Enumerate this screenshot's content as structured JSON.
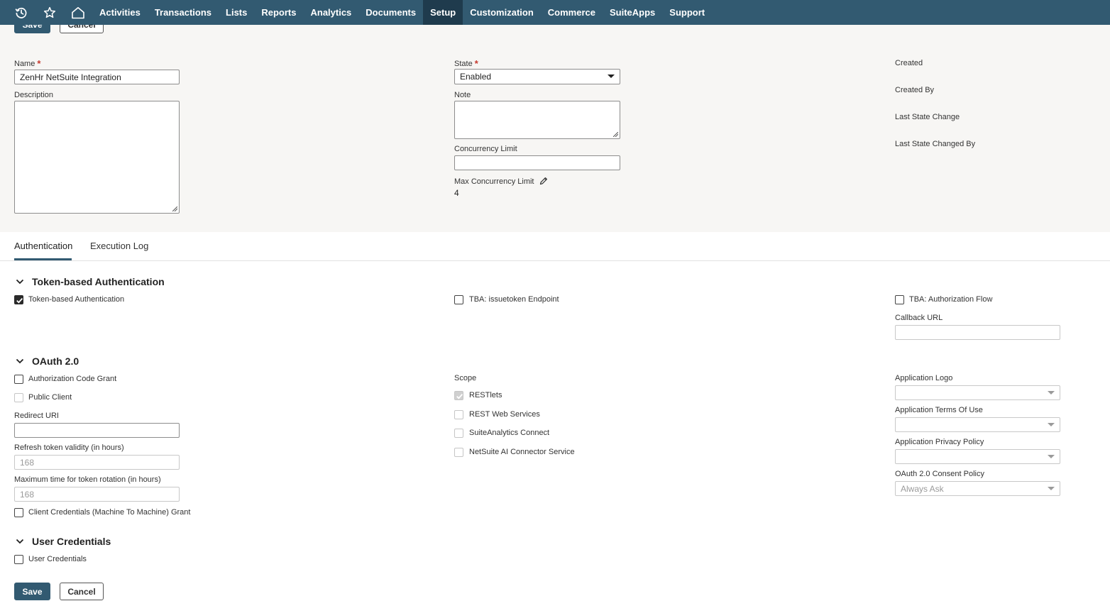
{
  "nav": {
    "icons": [
      "history-icon",
      "star-icon",
      "home-icon"
    ],
    "items": [
      "Activities",
      "Transactions",
      "Lists",
      "Reports",
      "Analytics",
      "Documents",
      "Setup",
      "Customization",
      "Commerce",
      "SuiteApps",
      "Support"
    ],
    "active": "Setup"
  },
  "buttons": {
    "save": "Save",
    "cancel": "Cancel"
  },
  "form": {
    "name_label": "Name",
    "name_value": "ZenHr NetSuite Integration",
    "description_label": "Description",
    "state_label": "State",
    "state_value": "Enabled",
    "note_label": "Note",
    "concurrency_label": "Concurrency Limit",
    "concurrency_value": "",
    "max_concurrency_label": "Max Concurrency Limit",
    "max_concurrency_value": "4",
    "created_label": "Created",
    "created_by_label": "Created By",
    "last_state_change_label": "Last State Change",
    "last_state_changed_by_label": "Last State Changed By"
  },
  "tabs": [
    "Authentication",
    "Execution Log"
  ],
  "tba": {
    "title": "Token-based Authentication",
    "tba_label": "Token-based Authentication",
    "tba_checked": true,
    "issuetoken_label": "TBA: issuetoken Endpoint",
    "issuetoken_checked": false,
    "auth_flow_label": "TBA: Authorization Flow",
    "auth_flow_checked": false,
    "callback_label": "Callback URL",
    "callback_value": ""
  },
  "oauth": {
    "title": "OAuth 2.0",
    "auth_code_label": "Authorization Code Grant",
    "public_client_label": "Public Client",
    "redirect_label": "Redirect URI",
    "refresh_label": "Refresh token validity (in hours)",
    "refresh_value": "168",
    "rotation_label": "Maximum time for token rotation (in hours)",
    "rotation_value": "168",
    "client_credentials_label": "Client Credentials (Machine To Machine) Grant",
    "scope_label": "Scope",
    "scopes": [
      {
        "label": "RESTlets",
        "checked": true
      },
      {
        "label": "REST Web Services",
        "checked": false
      },
      {
        "label": "SuiteAnalytics Connect",
        "checked": false
      },
      {
        "label": "NetSuite AI Connector Service",
        "checked": false
      }
    ],
    "logo_label": "Application Logo",
    "terms_label": "Application Terms Of Use",
    "privacy_label": "Application Privacy Policy",
    "consent_label": "OAuth 2.0 Consent Policy",
    "consent_value": "Always Ask"
  },
  "user_credentials": {
    "title": "User Credentials",
    "label": "User Credentials"
  }
}
